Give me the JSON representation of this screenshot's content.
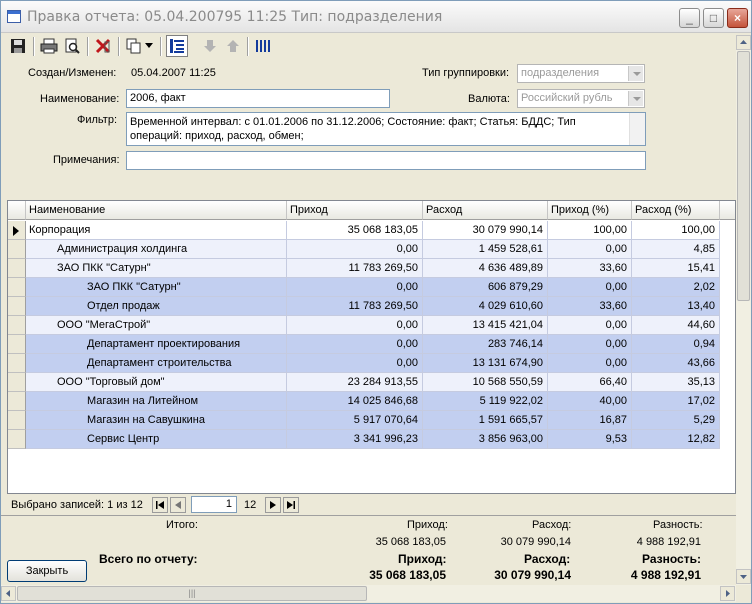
{
  "window": {
    "title": "Правка отчета: 05.04.200795 11:25  Тип: подразделения"
  },
  "form": {
    "created_label": "Создан/Изменен:",
    "created_value": "05.04.2007 11:25",
    "grouping_label": "Тип группировки:",
    "grouping_value": "подразделения",
    "name_label": "Наименование:",
    "name_value": "2006, факт",
    "currency_label": "Валюта:",
    "currency_value": "Российский рубль",
    "filter_label": "Фильтр:",
    "filter_line1": "Временной интервал: с 01.01.2006 по 31.12.2006;  Состояние: факт;  Статья: БДДС;  Тип",
    "filter_line2": "операций: приход, расход, обмен;",
    "notes_label": "Примечания:",
    "notes_value": ""
  },
  "grid": {
    "columns": [
      "Наименование",
      "Приход",
      "Расход",
      "Приход (%)",
      "Расход (%)"
    ],
    "rows": [
      {
        "name": "Корпорация",
        "income": "35 068 183,05",
        "expense": "30 079 990,14",
        "income_pct": "100,00",
        "expense_pct": "100,00",
        "level": 0
      },
      {
        "name": "Администрация холдинга",
        "income": "0,00",
        "expense": "1 459 528,61",
        "income_pct": "0,00",
        "expense_pct": "4,85",
        "level": 1
      },
      {
        "name": "ЗАО ПКК \"Сатурн\"",
        "income": "11 783 269,50",
        "expense": "4 636 489,89",
        "income_pct": "33,60",
        "expense_pct": "15,41",
        "level": 1
      },
      {
        "name": "ЗАО ПКК \"Сатурн\"",
        "income": "0,00",
        "expense": "606 879,29",
        "income_pct": "0,00",
        "expense_pct": "2,02",
        "level": 2
      },
      {
        "name": "Отдел продаж",
        "income": "11 783 269,50",
        "expense": "4 029 610,60",
        "income_pct": "33,60",
        "expense_pct": "13,40",
        "level": 2
      },
      {
        "name": "ООО \"МегаСтрой\"",
        "income": "0,00",
        "expense": "13 415 421,04",
        "income_pct": "0,00",
        "expense_pct": "44,60",
        "level": 1
      },
      {
        "name": "Департамент проектирования",
        "income": "0,00",
        "expense": "283 746,14",
        "income_pct": "0,00",
        "expense_pct": "0,94",
        "level": 2
      },
      {
        "name": "Департамент строительства",
        "income": "0,00",
        "expense": "13 131 674,90",
        "income_pct": "0,00",
        "expense_pct": "43,66",
        "level": 2
      },
      {
        "name": "ООО \"Торговый дом\"",
        "income": "23 284 913,55",
        "expense": "10 568 550,59",
        "income_pct": "66,40",
        "expense_pct": "35,13",
        "level": 1
      },
      {
        "name": "Магазин на Литейном",
        "income": "14 025 846,68",
        "expense": "5 119 922,02",
        "income_pct": "40,00",
        "expense_pct": "17,02",
        "level": 2
      },
      {
        "name": "Магазин на Савушкина",
        "income": "5 917 070,64",
        "expense": "1 591 665,57",
        "income_pct": "16,87",
        "expense_pct": "5,29",
        "level": 2
      },
      {
        "name": "Сервис Центр",
        "income": "3 341 996,23",
        "expense": "3 856 963,00",
        "income_pct": "9,53",
        "expense_pct": "12,82",
        "level": 2
      }
    ]
  },
  "nav": {
    "selected_text": "Выбрано записей: 1 из 12",
    "page": "1",
    "total": "12"
  },
  "totals": {
    "itogo_label": "Итого:",
    "income_label": "Приход:",
    "expense_label": "Расход:",
    "diff_label": "Разность:",
    "income_value": "35 068 183,05",
    "expense_value": "30 079 990,14",
    "diff_value": "4 988 192,91",
    "report_label": "Всего по отчету:",
    "report_income_label": "Приход:",
    "report_expense_label": "Расход:",
    "report_diff_label": "Разность:",
    "report_income_value": "35 068 183,05",
    "report_expense_value": "30 079 990,14",
    "report_diff_value": "4 988 192,91"
  },
  "buttons": {
    "close_label": "Закрыть"
  }
}
